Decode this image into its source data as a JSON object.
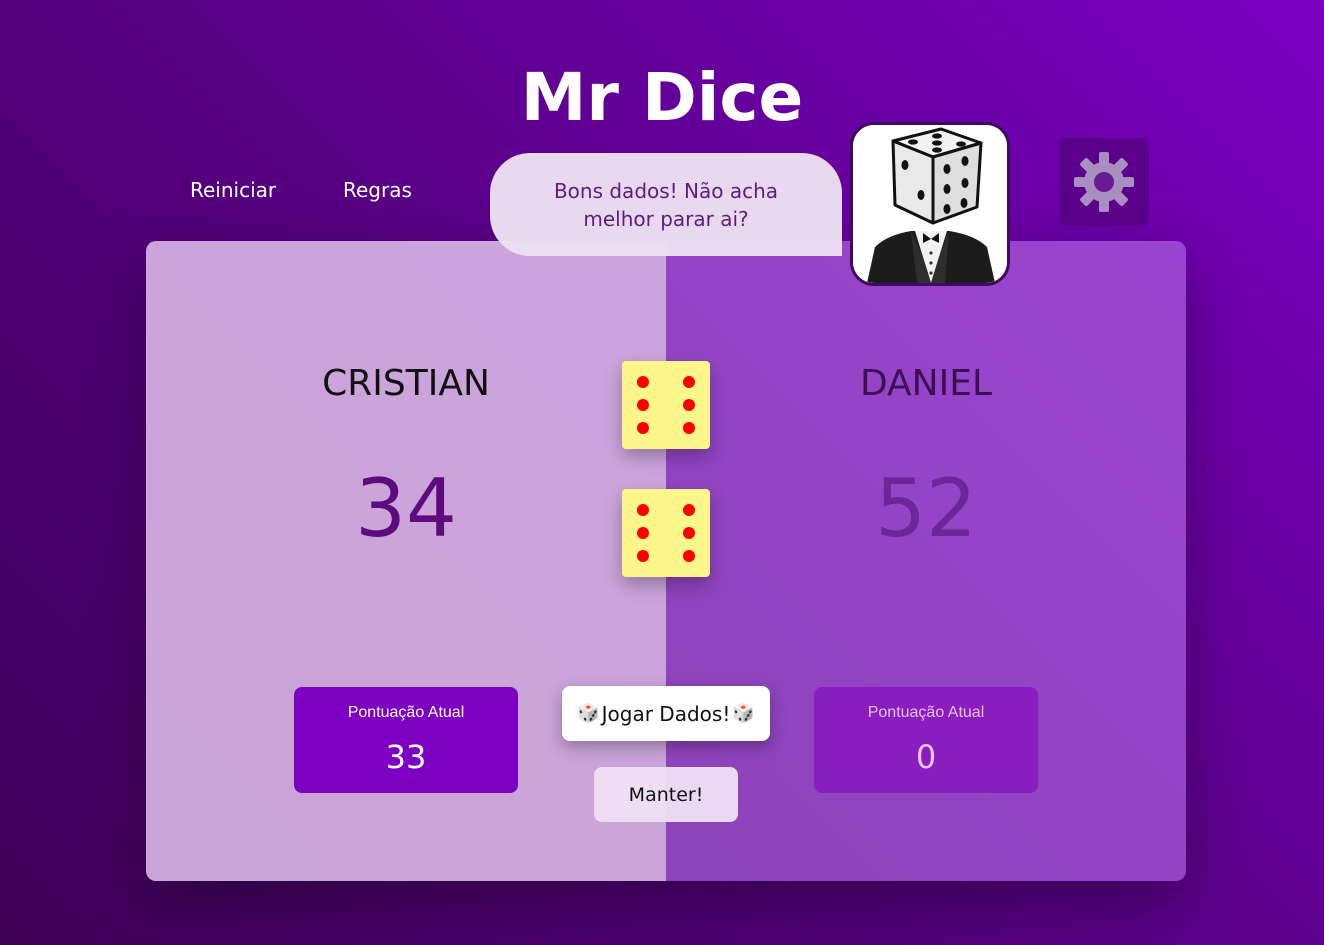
{
  "app": {
    "title": "Mr Dice"
  },
  "nav": {
    "restart_label": "Reiniciar",
    "rules_label": "Regras"
  },
  "bot": {
    "speech": "Bons dados! Não acha melhor parar ai?",
    "avatar_icon": "dice-head-man-in-tuxedo"
  },
  "settings": {
    "icon": "gear-icon"
  },
  "players": [
    {
      "name": "CRISTIAN",
      "score": "34",
      "current_label": "Pontuação Atual",
      "current_value": "33",
      "active": true
    },
    {
      "name": "DANIEL",
      "score": "52",
      "current_label": "Pontuação Atual",
      "current_value": "0",
      "active": false
    }
  ],
  "dice": [
    {
      "value": 6
    },
    {
      "value": 6
    }
  ],
  "controls": {
    "roll_emoji": "🎲",
    "roll_label": "Jogar Dados!",
    "hold_label": "Manter!"
  },
  "colors": {
    "background_dark": "#3d0056",
    "background_light": "#7a00c2",
    "die_face": "#fdf68a",
    "die_pip": "#ff0000",
    "active_current_box": "#7d00c2"
  }
}
